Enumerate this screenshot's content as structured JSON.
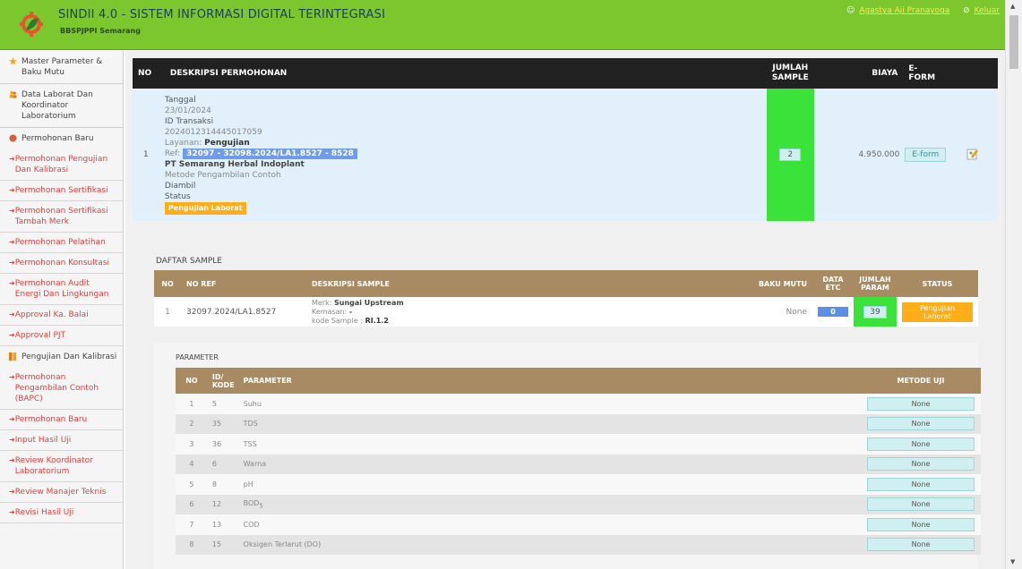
{
  "header": {
    "title": "SINDII 4.0 - SISTEM INFORMASI DIGITAL TERINTEGRASI",
    "subtitle": "BBSPJPPI Semarang",
    "user_name": "Agastya Aji Pranayoga",
    "logout_label": "Keluar"
  },
  "sidebar": {
    "sections": [
      {
        "label": "Master Parameter & Baku Mutu",
        "icon": "star-icon"
      },
      {
        "label": "Data Laborat Dan Koordinator Laboratorium",
        "icon": "users-icon"
      },
      {
        "label": "Permohonan Baru",
        "icon": "record-icon"
      }
    ],
    "items_permohonan": [
      "Permohonan Pengujian Dan Kalibrasi",
      "Permohonan Sertifikasi",
      "Permohonan Sertifikasi Tambah Merk",
      "Permohonan Pelatihan",
      "Permohonan Konsultasi",
      "Permohonan Audit Energi Dan Lingkungan",
      "Approval Ka. Balai",
      "Approval PJT"
    ],
    "section_pengujian": {
      "label": "Pengujian Dan Kalibrasi",
      "icon": "bars-icon"
    },
    "items_pengujian": [
      "Permohonan Pengambilan Contoh (BAPC)",
      "Permohonan Baru",
      "Input Hasil Uji",
      "Review Koordinator Laboratorium",
      "Review Manajer Teknis",
      "Revisi Hasil Uji"
    ]
  },
  "permohonan_table": {
    "headers": {
      "no": "NO",
      "desc": "DESKRIPSI PERMOHONAN",
      "jumlah": "JUMLAH SAMPLE",
      "biaya": "BIAYA",
      "eform": "E-FORM"
    },
    "row": {
      "no": "1",
      "tanggal_label": "Tanggal",
      "tanggal": "23/01/2024",
      "id_label": "ID Transaksi",
      "id": "2024012314445017059",
      "layanan_label": "Layanan:",
      "layanan": "Pengujian",
      "ref_label": "Ref:",
      "ref": "32097 - 32098.2024/LA1.8527 - 8528",
      "company": "PT Semarang Herbal Indoplant",
      "metode_label": "Metode Pengambilan Contoh",
      "metode": "Diambil",
      "status_label": "Status",
      "status": "Pengujian Laborat",
      "jumlah_sample": "2",
      "biaya": "4.950.000",
      "eform_button": "E-form",
      "edit_icon": "edit-icon"
    }
  },
  "daftar_sample": {
    "title": "DAFTAR SAMPLE",
    "headers": {
      "no": "NO",
      "ref": "NO REF",
      "desc": "DESKRIPSI SAMPLE",
      "baku": "BAKU MUTU",
      "data_etc": "DATA ETC",
      "jumlah_param": "JUMLAH PARAM",
      "status": "STATUS"
    },
    "rows": [
      {
        "no": "1",
        "ref": "32097.2024/LA1.8527",
        "merk_label": "Merk:",
        "merk": "Sungai Upstream",
        "kemasan_label": "Kemasan:",
        "kemasan": "-",
        "kode_label": "kode Sample :",
        "kode": "RI.1.2",
        "baku_mutu": "None",
        "data_etc": "0",
        "jumlah_param": "39",
        "status": "Pengujian Laborat"
      }
    ]
  },
  "parameter": {
    "title": "PARAMETER",
    "headers": {
      "no": "NO",
      "kode": "ID/ KODE",
      "param": "PARAMETER",
      "metode": "METODE UJI"
    },
    "rows": [
      {
        "no": "1",
        "kode": "5",
        "param": "Suhu",
        "metode": "None"
      },
      {
        "no": "2",
        "kode": "35",
        "param": "TDS",
        "metode": "None"
      },
      {
        "no": "3",
        "kode": "36",
        "param": "TSS",
        "metode": "None"
      },
      {
        "no": "4",
        "kode": "6",
        "param": "Warna",
        "metode": "None"
      },
      {
        "no": "5",
        "kode": "8",
        "param": "pH",
        "metode": "None"
      },
      {
        "no": "6",
        "kode": "12",
        "param": "BOD",
        "param_sub": "5",
        "metode": "None"
      },
      {
        "no": "7",
        "kode": "13",
        "param": "COD",
        "metode": "None"
      },
      {
        "no": "8",
        "kode": "15",
        "param": "Oksigen Terlarut (DO)",
        "metode": "None"
      }
    ]
  }
}
